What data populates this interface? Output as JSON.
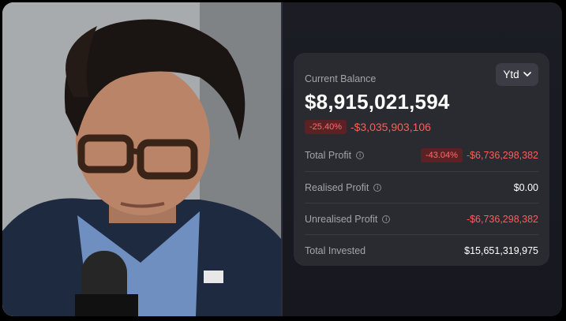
{
  "balance_card": {
    "current_balance_label": "Current Balance",
    "period_selector": "Ytd",
    "balance_value": "$8,915,021,594",
    "change_percent": "-25.40%",
    "change_amount": "-$3,035,903,106"
  },
  "stats": {
    "total_profit": {
      "label": "Total Profit",
      "percent": "-43.04%",
      "value": "-$6,736,298,382"
    },
    "realised_profit": {
      "label": "Realised Profit",
      "value": "$0.00"
    },
    "unrealised_profit": {
      "label": "Unrealised Profit",
      "value": "-$6,736,298,382"
    },
    "total_invested": {
      "label": "Total Invested",
      "value": "$15,651,319,975"
    }
  },
  "colors": {
    "negative": "#ff5c5c",
    "negative_badge_bg": "#5b2225",
    "card_bg": "#2a2b31",
    "pane_bg": "#1b1c24"
  },
  "icons": [
    "info-icon",
    "chevron-down-icon"
  ]
}
